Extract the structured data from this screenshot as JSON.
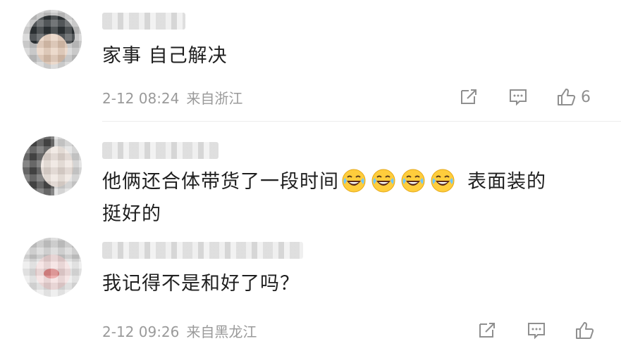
{
  "comments": [
    {
      "text": "家事 自己解决",
      "date": "2-12 08:24",
      "location": "来自浙江",
      "like_count": "6"
    },
    {
      "text_line1": "他俩还合体带货了一段时间",
      "text_after_emoji": "表面装的",
      "text_line2": "挺好的",
      "emoji": "laughing-with-tears-emoji"
    },
    {
      "text": "我记得不是和好了吗？",
      "date": "2-12 09:26",
      "location": "来自黑龙江",
      "like_count": ""
    }
  ],
  "icons": {
    "share": "share-icon",
    "comment": "comment-icon",
    "like": "thumbs-up-icon"
  },
  "colors": {
    "text": "#1f1f1f",
    "meta": "#9a9a9a",
    "icon": "#8f8f8f",
    "emoji_face": "#ffcd3c"
  }
}
